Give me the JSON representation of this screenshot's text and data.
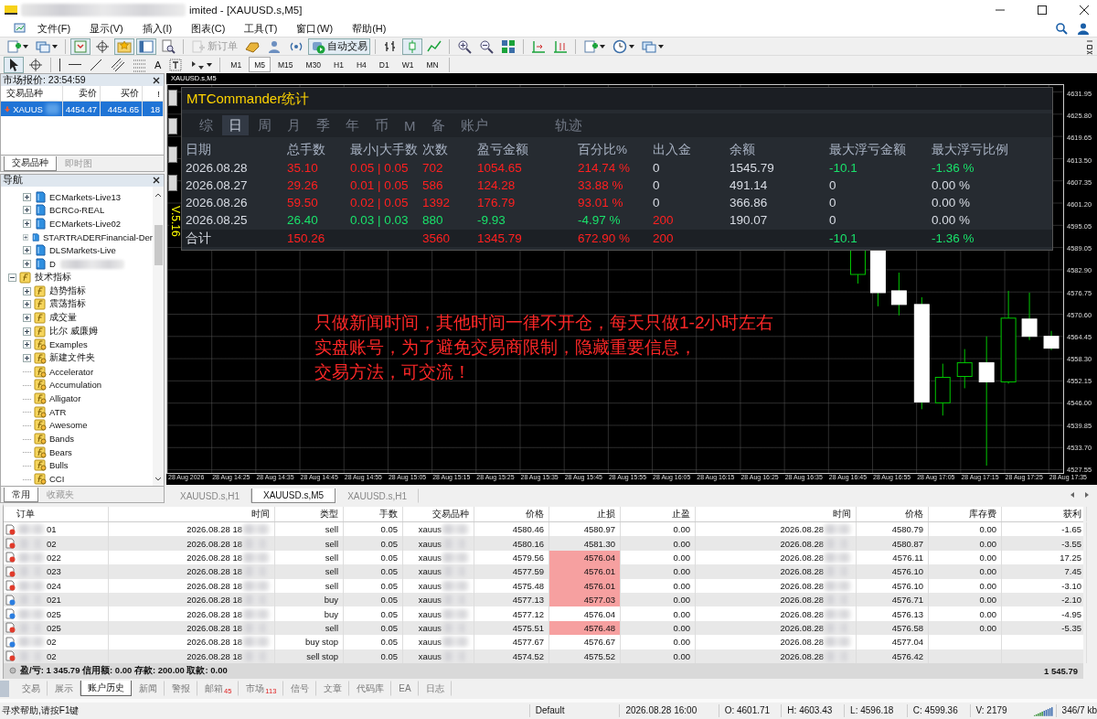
{
  "window": {
    "title": "imited - [XAUUSD.s,M5]"
  },
  "menu": [
    "文件(F)",
    "显示(V)",
    "插入(I)",
    "图表(C)",
    "工具(T)",
    "窗口(W)",
    "帮助(H)"
  ],
  "toolbar": [
    {
      "kind": "newchart",
      "caret": true
    },
    {
      "kind": "profiles",
      "caret": true
    },
    {
      "kind": "sep"
    },
    {
      "kind": "marketwatch",
      "pressed": true
    },
    {
      "kind": "datawindow",
      "pressed": false
    },
    {
      "kind": "navigator",
      "pressed": true
    },
    {
      "kind": "terminal",
      "pressed": true
    },
    {
      "kind": "tester",
      "pressed": false
    },
    {
      "kind": "sep"
    },
    {
      "kind": "order",
      "label": "新订单",
      "disabled": true
    },
    {
      "kind": "gold"
    },
    {
      "kind": "person"
    },
    {
      "kind": "signal"
    },
    {
      "kind": "autotrade",
      "label": "自动交易",
      "pressed": true
    },
    {
      "kind": "sep"
    },
    {
      "kind": "bars",
      "pressed": false
    },
    {
      "kind": "candles",
      "pressed": true
    },
    {
      "kind": "line",
      "pressed": false
    },
    {
      "kind": "sep"
    },
    {
      "kind": "zoomin"
    },
    {
      "kind": "zoomout"
    },
    {
      "kind": "tile"
    },
    {
      "kind": "sep"
    },
    {
      "kind": "shift",
      "pressed": false
    },
    {
      "kind": "autoscroll",
      "pressed": false
    },
    {
      "kind": "sep"
    },
    {
      "kind": "indicators",
      "caret": true
    },
    {
      "kind": "periods",
      "caret": true
    },
    {
      "kind": "templates",
      "caret": true
    }
  ],
  "toolbar2": [
    {
      "kind": "cursor",
      "pressed": true
    },
    {
      "kind": "crosshair",
      "pressed": false
    },
    {
      "kind": "sep"
    },
    {
      "kind": "vline"
    },
    {
      "kind": "hline"
    },
    {
      "kind": "trend"
    },
    {
      "kind": "channel"
    },
    {
      "kind": "fibo"
    },
    {
      "kind": "text",
      "label": "A"
    },
    {
      "kind": "label"
    },
    {
      "kind": "arrows",
      "caret": true
    }
  ],
  "timeframes": [
    {
      "label": "M1",
      "selected": false
    },
    {
      "label": "M5",
      "selected": true
    },
    {
      "label": "M15",
      "selected": false
    },
    {
      "label": "M30",
      "selected": false
    },
    {
      "label": "H1",
      "selected": false
    },
    {
      "label": "H4",
      "selected": false
    },
    {
      "label": "D1",
      "selected": false
    },
    {
      "label": "W1",
      "selected": false
    },
    {
      "label": "MN",
      "selected": false
    }
  ],
  "market_watch": {
    "title": "市场报价: 23:54:59",
    "columns": [
      "交易品种",
      "卖价",
      "买价",
      "!"
    ],
    "rows": [
      {
        "symbol": "XAUUS",
        "bid": "4454.47",
        "ask": "4454.65",
        "spread": "18",
        "selected": true
      }
    ],
    "tabs": [
      {
        "label": "交易品种",
        "selected": true
      },
      {
        "label": "即时图",
        "selected": false
      }
    ]
  },
  "navigator": {
    "title": "导航",
    "servers": [
      {
        "label": "ECMarkets-Live13",
        "expanded": false
      },
      {
        "label": "BCRCo-REAL",
        "expanded": false
      },
      {
        "label": "ECMarkets-Live02",
        "expanded": false
      },
      {
        "label": "STARTRADERFinancial-Der",
        "expanded": false
      },
      {
        "label": "DLSMarkets-Live",
        "expanded": false
      },
      {
        "label": "D",
        "expanded": false
      }
    ],
    "tree": [
      {
        "label": "技术指标",
        "kind": "folder",
        "expanded": true,
        "children": [
          {
            "label": "趋势指标",
            "kind": "folder",
            "expanded": false
          },
          {
            "label": "震荡指标",
            "kind": "folder",
            "expanded": false
          },
          {
            "label": "成交量",
            "kind": "folder",
            "expanded": false
          },
          {
            "label": "比尔 威廉姆",
            "kind": "folder",
            "expanded": false
          },
          {
            "label": "Examples",
            "kind": "group",
            "expanded": false
          },
          {
            "label": "新建文件夹",
            "kind": "group",
            "expanded": false
          },
          {
            "label": "Accelerator",
            "kind": "indicator"
          },
          {
            "label": "Accumulation",
            "kind": "indicator"
          },
          {
            "label": "Alligator",
            "kind": "indicator"
          },
          {
            "label": "ATR",
            "kind": "indicator"
          },
          {
            "label": "Awesome",
            "kind": "indicator"
          },
          {
            "label": "Bands",
            "kind": "indicator"
          },
          {
            "label": "Bears",
            "kind": "indicator"
          },
          {
            "label": "Bulls",
            "kind": "indicator"
          },
          {
            "label": "CCI",
            "kind": "indicator"
          }
        ]
      }
    ],
    "tabs": [
      {
        "label": "常用",
        "selected": true
      },
      {
        "label": "收藏夹",
        "selected": false
      }
    ]
  },
  "chart": {
    "title": "XAUUSD.s,M5",
    "version": "V.5.16",
    "price_axis": [
      "4631.95",
      "4625.80",
      "4619.65",
      "4613.50",
      "4607.35",
      "4601.20",
      "4595.05",
      "4589.05",
      "4582.90",
      "4576.75",
      "4570.60",
      "4564.45",
      "4558.30",
      "4552.15",
      "4546.00",
      "4539.85",
      "4533.70",
      "4527.55"
    ],
    "time_axis": [
      "28 Aug 2026",
      "28 Aug 14:25",
      "28 Aug 14:35",
      "28 Aug 14:45",
      "28 Aug 14:55",
      "28 Aug 15:05",
      "28 Aug 15:15",
      "28 Aug 15:25",
      "28 Aug 15:35",
      "28 Aug 15:45",
      "28 Aug 15:55",
      "28 Aug 16:05",
      "28 Aug 16:15",
      "28 Aug 16:25",
      "28 Aug 16:35",
      "28 Aug 16:45",
      "28 Aug 16:55",
      "28 Aug 17:05",
      "28 Aug 17:15",
      "28 Aug 17:25",
      "28 Aug 17:35"
    ],
    "note": [
      "只做新闻时间，其他时间一律不开仓，每天只做1-2小时左右",
      "实盘账号，为了避免交易商限制，隐藏重要信息，",
      "交易方法，可交流！"
    ],
    "tabs": [
      {
        "label": "XAUUSD.s,H1",
        "selected": false
      },
      {
        "label": "XAUUSD.s,M5",
        "selected": true
      },
      {
        "label": "XAUUSD.s,H1",
        "selected": false
      }
    ]
  },
  "stats": {
    "title": "MTCommander统计",
    "tabs": [
      {
        "label": "综",
        "selected": false
      },
      {
        "label": "日",
        "selected": true
      },
      {
        "label": "周",
        "selected": false
      },
      {
        "label": "月",
        "selected": false
      },
      {
        "label": "季",
        "selected": false
      },
      {
        "label": "年",
        "selected": false
      },
      {
        "label": "币",
        "selected": false
      },
      {
        "label": "M",
        "selected": false
      },
      {
        "label": "备",
        "selected": false
      },
      {
        "label": "账户",
        "selected": false
      },
      {
        "label": "轨迹",
        "selected": false
      }
    ],
    "columns": [
      "日期",
      "总手数",
      "最小|大手数",
      "次数",
      "盈亏金额",
      "百分比%",
      "出入金",
      "余额",
      "最大浮亏金额",
      "最大浮亏比例"
    ],
    "rows": [
      {
        "cells": [
          {
            "text": "2026.08.28",
            "color": "#d8dce4"
          },
          {
            "text": "35.10",
            "color": "#ff2020"
          },
          {
            "text": "0.05 | 0.05",
            "color": "#ff2020"
          },
          {
            "text": "702",
            "color": "#ff2020"
          },
          {
            "text": "1054.65",
            "color": "#ff2020"
          },
          {
            "text": "214.74 %",
            "color": "#ff2020"
          },
          {
            "text": "0",
            "color": "#d8dce4"
          },
          {
            "text": "1545.79",
            "color": "#d8dce4"
          },
          {
            "text": "-10.1",
            "color": "#19e36b"
          },
          {
            "text": "-1.36 %",
            "color": "#19e36b"
          }
        ]
      },
      {
        "cells": [
          {
            "text": "2026.08.27",
            "color": "#d8dce4"
          },
          {
            "text": "29.26",
            "color": "#ff2020"
          },
          {
            "text": "0.01 | 0.05",
            "color": "#ff2020"
          },
          {
            "text": "586",
            "color": "#ff2020"
          },
          {
            "text": "124.28",
            "color": "#ff2020"
          },
          {
            "text": "33.88 %",
            "color": "#ff2020"
          },
          {
            "text": "0",
            "color": "#d8dce4"
          },
          {
            "text": "491.14",
            "color": "#d8dce4"
          },
          {
            "text": "0",
            "color": "#d8dce4"
          },
          {
            "text": "0.00 %",
            "color": "#d8dce4"
          }
        ]
      },
      {
        "cells": [
          {
            "text": "2026.08.26",
            "color": "#d8dce4"
          },
          {
            "text": "59.50",
            "color": "#ff2020"
          },
          {
            "text": "0.02 | 0.05",
            "color": "#ff2020"
          },
          {
            "text": "1392",
            "color": "#ff2020"
          },
          {
            "text": "176.79",
            "color": "#ff2020"
          },
          {
            "text": "93.01 %",
            "color": "#ff2020"
          },
          {
            "text": "0",
            "color": "#d8dce4"
          },
          {
            "text": "366.86",
            "color": "#d8dce4"
          },
          {
            "text": "0",
            "color": "#d8dce4"
          },
          {
            "text": "0.00 %",
            "color": "#d8dce4"
          }
        ]
      },
      {
        "cells": [
          {
            "text": "2026.08.25",
            "color": "#d8dce4"
          },
          {
            "text": "26.40",
            "color": "#19e36b"
          },
          {
            "text": "0.03 | 0.03",
            "color": "#19e36b"
          },
          {
            "text": "880",
            "color": "#19e36b"
          },
          {
            "text": "-9.93",
            "color": "#19e36b"
          },
          {
            "text": "-4.97 %",
            "color": "#19e36b"
          },
          {
            "text": "200",
            "color": "#ff2020"
          },
          {
            "text": "190.07",
            "color": "#d8dce4"
          },
          {
            "text": "0",
            "color": "#d8dce4"
          },
          {
            "text": "0.00 %",
            "color": "#d8dce4"
          }
        ]
      }
    ],
    "total": {
      "cells": [
        {
          "text": "合计",
          "color": "#d8dce4"
        },
        {
          "text": "150.26",
          "color": "#ff2020"
        },
        null,
        {
          "text": "3560",
          "color": "#ff2020"
        },
        {
          "text": "1345.79",
          "color": "#ff2020"
        },
        {
          "text": "672.90 %",
          "color": "#ff2020"
        },
        {
          "text": "200",
          "color": "#ff2020"
        },
        null,
        {
          "text": "-10.1",
          "color": "#19e36b"
        },
        {
          "text": "-1.36 %",
          "color": "#19e36b"
        }
      ]
    }
  },
  "terminal": {
    "columns": [
      "订单",
      "时间",
      "类型",
      "手数",
      "交易品种",
      "价格",
      "止损",
      "止盈",
      "时间",
      "价格",
      "库存费",
      "获利"
    ],
    "rows": [
      {
        "kind": "sell",
        "sl_alert": false,
        "cells": [
          "01",
          "2026.08.28 18",
          "sell",
          "0.05",
          "xauus",
          "4580.46",
          "4580.97",
          "0.00",
          "2026.08.28",
          "4580.79",
          "0.00",
          "-1.65"
        ]
      },
      {
        "kind": "sell",
        "sl_alert": false,
        "cells": [
          "02",
          "2026.08.28 18",
          "sell",
          "0.05",
          "xauus",
          "4580.16",
          "4581.30",
          "0.00",
          "2026.08.28",
          "4580.87",
          "0.00",
          "-3.55"
        ]
      },
      {
        "kind": "sell",
        "sl_alert": true,
        "cells": [
          "022",
          "2026.08.28 18",
          "sell",
          "0.05",
          "xauus",
          "4579.56",
          "4576.04",
          "0.00",
          "2026.08.28",
          "4576.11",
          "0.00",
          "17.25"
        ]
      },
      {
        "kind": "sell",
        "sl_alert": true,
        "cells": [
          "023",
          "2026.08.28 18",
          "sell",
          "0.05",
          "xauus",
          "4577.59",
          "4576.01",
          "0.00",
          "2026.08.28",
          "4576.10",
          "0.00",
          "7.45"
        ]
      },
      {
        "kind": "sell",
        "sl_alert": true,
        "cells": [
          "024",
          "2026.08.28 18",
          "sell",
          "0.05",
          "xauus",
          "4575.48",
          "4576.01",
          "0.00",
          "2026.08.28",
          "4576.10",
          "0.00",
          "-3.10"
        ]
      },
      {
        "kind": "buy",
        "sl_alert": true,
        "cells": [
          "021",
          "2026.08.28 18",
          "buy",
          "0.05",
          "xauus",
          "4577.13",
          "4577.03",
          "0.00",
          "2026.08.28",
          "4576.71",
          "0.00",
          "-2.10"
        ]
      },
      {
        "kind": "buy",
        "sl_alert": false,
        "cells": [
          "025",
          "2026.08.28 18",
          "buy",
          "0.05",
          "xauus",
          "4577.12",
          "4576.04",
          "0.00",
          "2026.08.28",
          "4576.13",
          "0.00",
          "-4.95"
        ]
      },
      {
        "kind": "sell",
        "sl_alert": true,
        "cells": [
          "025",
          "2026.08.28 18",
          "sell",
          "0.05",
          "xauus",
          "4575.51",
          "4576.48",
          "0.00",
          "2026.08.28",
          "4576.58",
          "0.00",
          "-5.35"
        ]
      },
      {
        "kind": "buy",
        "sl_alert": false,
        "cells": [
          "02",
          "2026.08.28 18",
          "buy stop",
          "0.05",
          "xauus",
          "4577.67",
          "4576.67",
          "0.00",
          "2026.08.28",
          "4577.04",
          null,
          null
        ]
      },
      {
        "kind": "sell",
        "sl_alert": false,
        "cells": [
          "02",
          "2026.08.28 18",
          "sell stop",
          "0.05",
          "xauus",
          "4574.52",
          "4575.52",
          "0.00",
          "2026.08.28",
          "4576.42",
          null,
          null
        ]
      }
    ],
    "summary": "盈/亏: 1 345.79  信用额: 0.00  存款: 200.00  取款: 0.00",
    "total": "1 545.79"
  },
  "bottom_tabs": [
    {
      "label": "交易",
      "selected": false
    },
    {
      "label": "展示",
      "selected": false
    },
    {
      "label": "账户历史",
      "selected": true
    },
    {
      "label": "新闻",
      "selected": false
    },
    {
      "label": "警报",
      "selected": false
    },
    {
      "label": "邮箱",
      "badge": "45",
      "selected": false
    },
    {
      "label": "市场",
      "badge": "113",
      "selected": false
    },
    {
      "label": "信号",
      "selected": false
    },
    {
      "label": "文章",
      "selected": false
    },
    {
      "label": "代码库",
      "selected": false
    },
    {
      "label": "EA",
      "selected": false
    },
    {
      "label": "日志",
      "selected": false
    }
  ],
  "status": {
    "help": "寻求帮助,请按F1键",
    "profile": "Default",
    "time": "2026.08.28 16:00",
    "open": "O: 4601.71",
    "high": "H: 4603.43",
    "low": "L: 4596.18",
    "close": "C: 4599.36",
    "volume": "V: 2179",
    "traffic": "346/7 kb"
  }
}
